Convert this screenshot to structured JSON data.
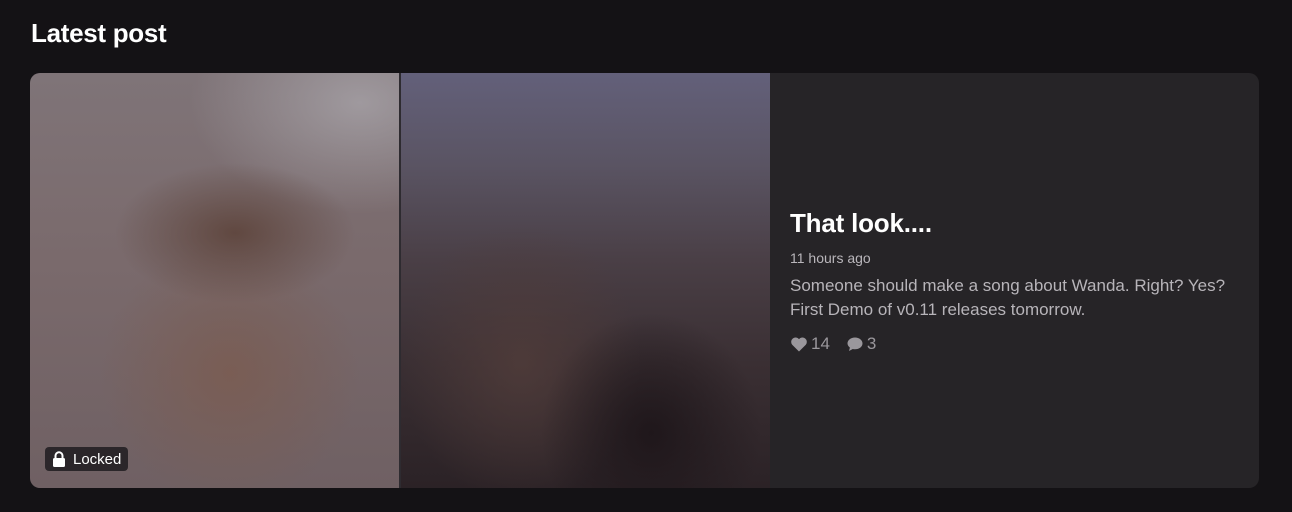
{
  "section": {
    "title": "Latest post"
  },
  "post": {
    "title": "That look....",
    "time_ago": "11 hours ago",
    "excerpt": "Someone should make a song about Wanda. Right? Yes? First Demo of v0.11 releases tomorrow.",
    "locked_label": "Locked",
    "likes": "14",
    "comments": "3",
    "icons": {
      "lock": "lock-icon",
      "like": "heart-icon",
      "comment": "comment-bubble-icon"
    }
  },
  "colors": {
    "background": "#141215",
    "card": "#262427",
    "title_text": "#ffffff",
    "muted_text": "#b7b4b9",
    "stat_text": "#9a979c"
  }
}
